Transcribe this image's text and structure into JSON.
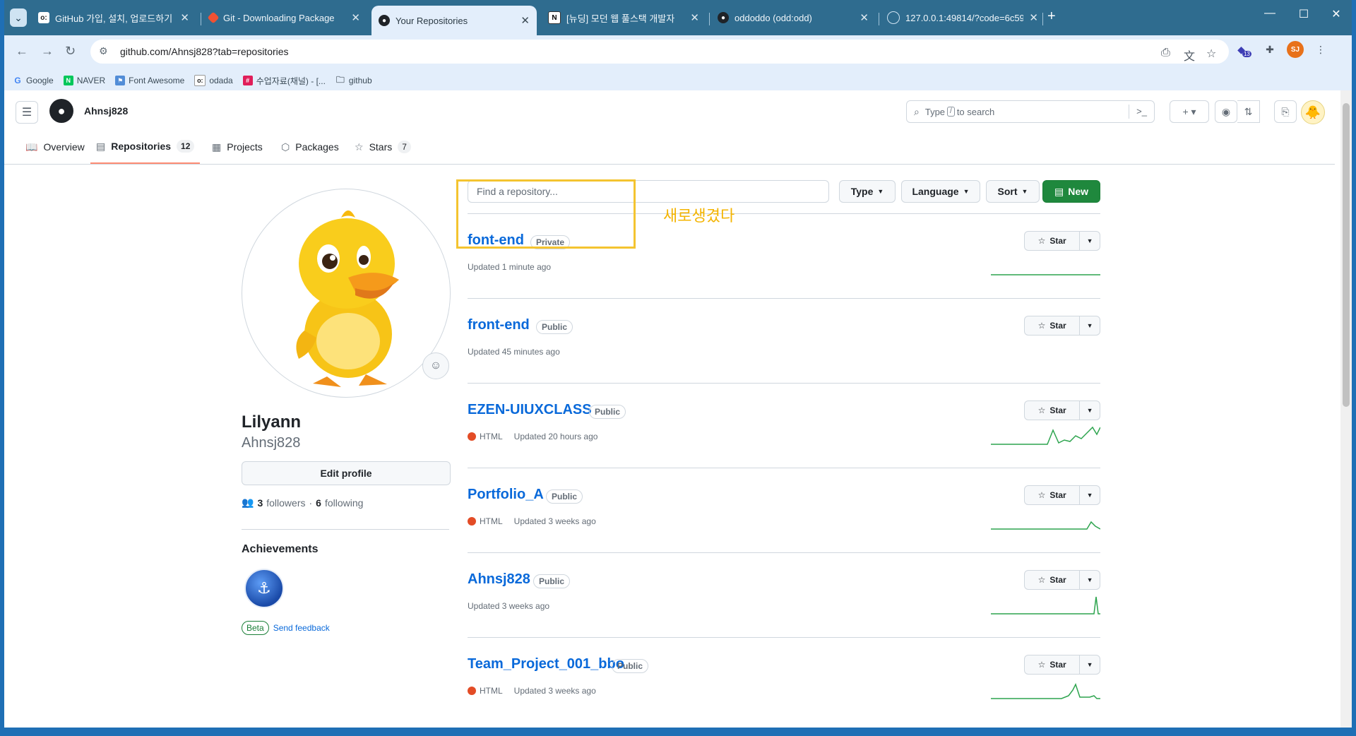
{
  "browser": {
    "tabs": [
      {
        "title": "GitHub 가입, 설치, 업로드하기",
        "favicon": "odada-icon",
        "active": false
      },
      {
        "title": "Git - Downloading Package",
        "favicon": "git-icon",
        "active": false
      },
      {
        "title": "Your Repositories",
        "favicon": "github-icon",
        "active": true
      },
      {
        "title": "[뉴딩] 모던 웹 풀스택 개발자",
        "favicon": "notion-icon",
        "active": false
      },
      {
        "title": "oddoddo (odd:odd)",
        "favicon": "github-icon",
        "active": false
      },
      {
        "title": "127.0.0.1:49814/?code=6c595e",
        "favicon": "page-icon",
        "active": false
      }
    ],
    "url": "github.com/Ahnsj828?tab=repositories",
    "profile_initials": "SJ",
    "extension_badge": "13",
    "bookmarks": [
      {
        "label": "Google",
        "icon": "google-icon"
      },
      {
        "label": "NAVER",
        "icon": "naver-icon"
      },
      {
        "label": "Font Awesome",
        "icon": "flag-icon"
      },
      {
        "label": "odada",
        "icon": "odada-icon"
      },
      {
        "label": "수업자료(채널) - [...",
        "icon": "slack-icon"
      },
      {
        "label": "github",
        "icon": "folder-icon"
      }
    ]
  },
  "github": {
    "username": "Ahnsj828",
    "search_placeholder_prefix": "Type",
    "search_key": "/",
    "search_placeholder_suffix": "to search",
    "nav_tabs": [
      {
        "label": "Overview",
        "icon": "book-icon"
      },
      {
        "label": "Repositories",
        "icon": "repo-icon",
        "count": "12",
        "selected": true
      },
      {
        "label": "Projects",
        "icon": "table-icon"
      },
      {
        "label": "Packages",
        "icon": "package-icon"
      },
      {
        "label": "Stars",
        "icon": "star-icon",
        "count": "7"
      }
    ],
    "profile": {
      "name": "Lilyann",
      "login": "Ahnsj828",
      "edit_label": "Edit profile",
      "followers": "3",
      "followers_label": "followers",
      "following": "6",
      "following_label": "following",
      "achievements_title": "Achievements",
      "beta_label": "Beta",
      "feedback_label": "Send feedback"
    },
    "filters": {
      "find_placeholder": "Find a repository...",
      "type_label": "Type",
      "language_label": "Language",
      "sort_label": "Sort",
      "new_label": "New"
    },
    "star_label": "Star",
    "repos": [
      {
        "name": "font-end",
        "visibility": "Private",
        "language": "",
        "updated": "Updated 1 minute ago"
      },
      {
        "name": "front-end",
        "visibility": "Public",
        "language": "",
        "updated": "Updated 45 minutes ago"
      },
      {
        "name": "EZEN-UIUXCLASS",
        "visibility": "Public",
        "language": "HTML",
        "updated": "Updated 20 hours ago"
      },
      {
        "name": "Portfolio_A",
        "visibility": "Public",
        "language": "HTML",
        "updated": "Updated 3 weeks ago"
      },
      {
        "name": "Ahnsj828",
        "visibility": "Public",
        "language": "",
        "updated": "Updated 3 weeks ago"
      },
      {
        "name": "Team_Project_001_bbo",
        "visibility": "Public",
        "language": "HTML",
        "updated": "Updated 3 weeks ago"
      }
    ],
    "annotation": "새로생겼다"
  },
  "colors": {
    "html_language": "#e34c26",
    "sparkline": "#2da44e",
    "highlight": "#f4c430",
    "new_button": "#1f883d"
  }
}
